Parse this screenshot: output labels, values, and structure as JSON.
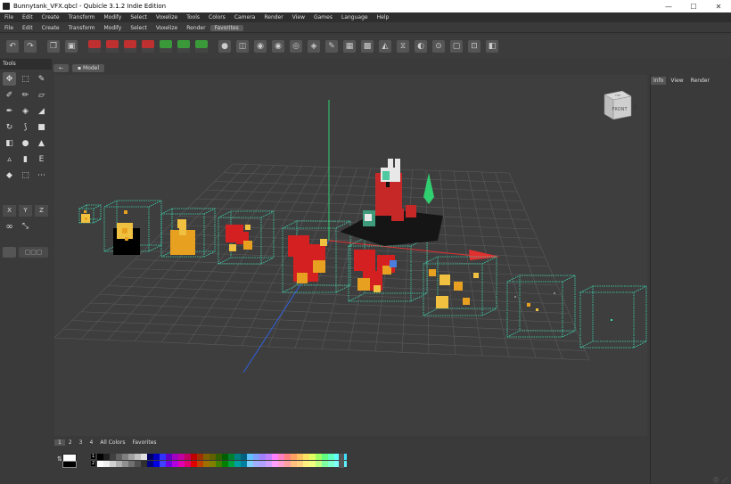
{
  "window": {
    "title": "Bunnytank_VFX.qbcl - Qubicle 3.1.2 Indie Edition",
    "minimize": "—",
    "maximize": "☐",
    "close": "✕"
  },
  "menu_main": [
    "File",
    "Edit",
    "Create",
    "Transform",
    "Modify",
    "Select",
    "Voxelize",
    "Tools",
    "Colors",
    "Camera",
    "Render",
    "View",
    "Games",
    "Language",
    "Help"
  ],
  "menu_favorites": [
    "File",
    "Edit",
    "Create",
    "Transform",
    "Modify",
    "Select",
    "Voxelize",
    "Render",
    "Favorites"
  ],
  "menu_favorites_active": "Favorites",
  "toolbar_icons": [
    "undo-icon",
    "redo-icon",
    "copy-icon",
    "paste-icon",
    "red-cube-icon-1",
    "red-cube-icon-2",
    "red-cube-icon-3",
    "red-cube-icon-4",
    "green-cube-icon-1",
    "green-cube-icon-2",
    "green-cube-icon-3",
    "sphere-icon",
    "layers-icon",
    "color-wheel-icon",
    "eye-icon",
    "eye-alt-icon",
    "bucket-icon",
    "pencil-icon",
    "checker-icon",
    "matrix-icon",
    "mirror-icon",
    "merge-icon",
    "face-icon",
    "target-icon",
    "frame-icon",
    "frame-alt-icon",
    "cubes-icon"
  ],
  "tools_panel": {
    "header": "Tools",
    "axis": [
      "X",
      "Y",
      "Z"
    ]
  },
  "viewport": {
    "tab_label": "Model",
    "back_arrow": "←",
    "viewcube_front": "FRONT",
    "viewcube_top": "TOP"
  },
  "right_panel": {
    "tabs": [
      "Info",
      "View",
      "Render"
    ],
    "active_tab": "Info"
  },
  "palette": {
    "tabs": [
      "1",
      "2",
      "3",
      "4",
      "All Colors",
      "Favorites"
    ],
    "active_tab": "1",
    "slot_labels": [
      "1",
      "2"
    ],
    "colors": [
      "#000000",
      "#202020",
      "#404040",
      "#606060",
      "#808080",
      "#a0a0a0",
      "#c0c0c0",
      "#e0e0e0",
      "#000060",
      "#0000c0",
      "#3030ff",
      "#6000c0",
      "#a000c0",
      "#c000a0",
      "#c00060",
      "#c00000",
      "#a03000",
      "#806000",
      "#606000",
      "#306000",
      "#006000",
      "#008030",
      "#008080",
      "#006080",
      "#60c0ff",
      "#80a0ff",
      "#a080ff",
      "#c080ff",
      "#ff80ff",
      "#ff80c0",
      "#ff8080",
      "#ffa060",
      "#ffc060",
      "#ffe060",
      "#e0ff60",
      "#a0ff60",
      "#60ff80",
      "#60ffc0",
      "#60ffff",
      "#40e0ff"
    ],
    "colors_row2": [
      "#ffffff",
      "#f0f0f0",
      "#d0d0d0",
      "#b0b0b0",
      "#909090",
      "#707070",
      "#505050",
      "#303030",
      "#000080",
      "#0000e0",
      "#4040ff",
      "#7000e0",
      "#b000e0",
      "#e000b0",
      "#e00070",
      "#e00000",
      "#c04000",
      "#a07000",
      "#808000",
      "#408000",
      "#008000",
      "#00a040",
      "#00a0a0",
      "#0080a0",
      "#80d0ff",
      "#a0b0ff",
      "#b0a0ff",
      "#d0a0ff",
      "#ffa0ff",
      "#ffa0d0",
      "#ffa0a0",
      "#ffc080",
      "#ffd080",
      "#fff080",
      "#f0ff80",
      "#c0ff80",
      "#80ffa0",
      "#80ffd0",
      "#80ffff",
      "#60f0ff"
    ]
  },
  "status_icons": [
    "info-icon",
    "resize-grip-icon"
  ],
  "colors": {
    "grid": "#5a5a5a",
    "bounding_box": "#3fd9b0",
    "axis_x": "#e03030",
    "axis_y": "#30d070",
    "axis_z": "#3060e0",
    "voxel_red": "#d42020",
    "voxel_orange": "#e8a020",
    "voxel_yellow": "#f0c040"
  }
}
